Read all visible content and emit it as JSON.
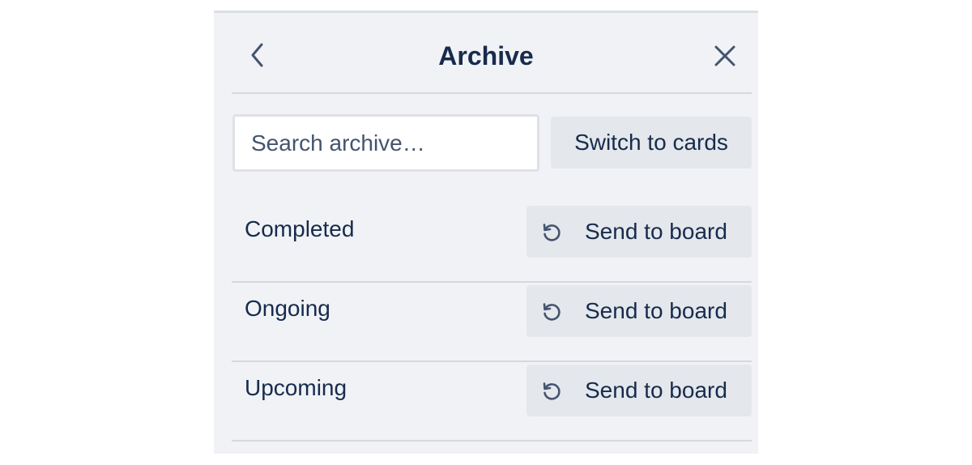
{
  "header": {
    "title": "Archive",
    "back_icon": "chevron-left-icon",
    "close_icon": "close-icon"
  },
  "search": {
    "placeholder": "Search archive…",
    "value": ""
  },
  "switch_button": {
    "label": "Switch to cards"
  },
  "archived_lists": [
    {
      "name": "Completed",
      "action_label": "Send to board",
      "action_icon": "restore-icon"
    },
    {
      "name": "Ongoing",
      "action_label": "Send to board",
      "action_icon": "restore-icon"
    },
    {
      "name": "Upcoming",
      "action_label": "Send to board",
      "action_icon": "restore-icon"
    }
  ],
  "colors": {
    "panel_background": "#f0f2f5",
    "text": "#172b4d",
    "button_background": "#e4e7eb",
    "divider": "#d5d8dd"
  }
}
